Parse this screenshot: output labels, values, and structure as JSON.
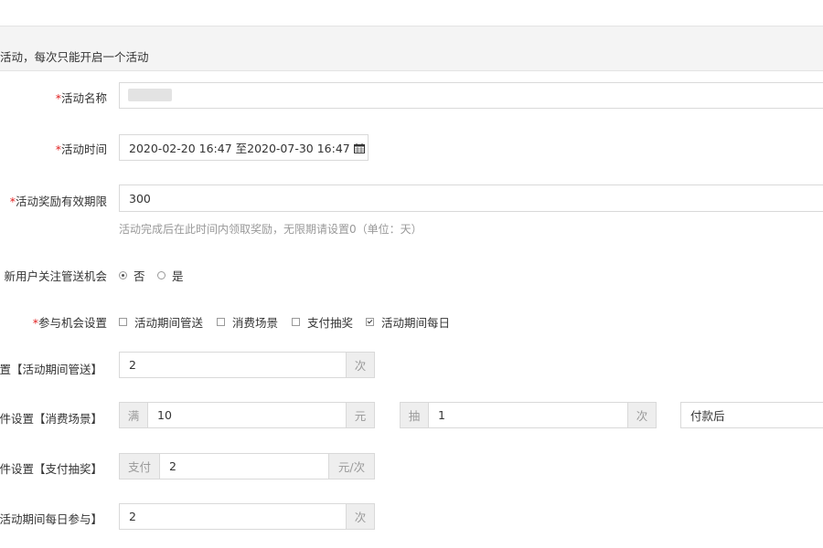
{
  "section": {
    "title": "活动，每次只能开启一个活动"
  },
  "form": {
    "name": {
      "label": "活动名称",
      "required": "*"
    },
    "time": {
      "label": "活动时间",
      "required": "*",
      "value": "2020-02-20 16:47 至2020-07-30 16:47"
    },
    "validity": {
      "label": "活动奖励有效期限",
      "required": "*",
      "value": "300",
      "hint": "活动完成后在此时间内领取奖励，无限期请设置0（单位：天）"
    },
    "new_user": {
      "label": "新用户关注管送机会",
      "options": [
        "否",
        "是"
      ],
      "selected": "否"
    },
    "participation": {
      "label": "参与机会设置",
      "required": "*",
      "options": [
        {
          "label": "活动期间管送",
          "checked": false
        },
        {
          "label": "消费场景",
          "checked": false
        },
        {
          "label": "支付抽奖",
          "checked": false
        },
        {
          "label": "活动期间每日",
          "checked": true
        }
      ]
    },
    "row_gift": {
      "label": "置【活动期间管送】",
      "value": "2",
      "unit": "次"
    },
    "row_consume": {
      "label": "件设置【消费场景】",
      "prefix": "满",
      "value": "10",
      "unit": "元",
      "prefix2": "抽",
      "value2": "1",
      "unit2": "次",
      "select_value": "付款后"
    },
    "row_pay": {
      "label": "件设置【支付抽奖】",
      "prefix": "支付",
      "value": "2",
      "unit": "元/次"
    },
    "row_daily": {
      "label": "活动期间每日参与】",
      "value": "2",
      "unit": "次"
    }
  }
}
